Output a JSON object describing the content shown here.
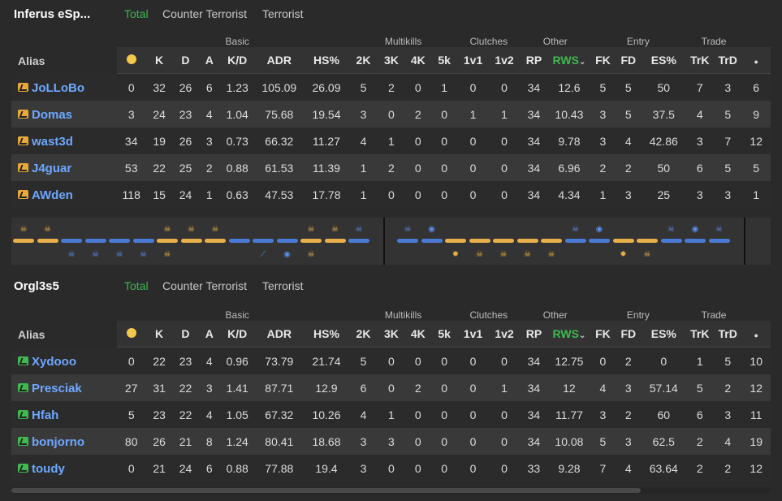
{
  "teams": [
    {
      "name": "Inferus eSp...",
      "tabs": [
        "Total",
        "Counter Terrorist",
        "Terrorist"
      ],
      "groups": {
        "basic": "Basic",
        "multikills": "Multikills",
        "clutches": "Clutches",
        "other": "Other",
        "entry": "Entry",
        "trade": "Trade"
      },
      "columns": {
        "alias": "Alias",
        "k": "K",
        "d": "D",
        "a": "A",
        "kd": "K/D",
        "adr": "ADR",
        "hs": "HS%",
        "k2": "2K",
        "k3": "3K",
        "k4": "4K",
        "k5": "5k",
        "c1": "1v1",
        "c2": "1v2",
        "rp": "RP",
        "rws": "RWS",
        "rws_sort": "⌄",
        "fk": "FK",
        "fd": "FD",
        "es": "ES%",
        "trk": "TrK",
        "trd": "TrD"
      },
      "players": [
        {
          "alias": "JoLLoBo",
          "mvp": "0",
          "k": "32",
          "d": "26",
          "a": "6",
          "kd": "1.23",
          "adr": "105.09",
          "hs": "26.09",
          "k2": "5",
          "k3": "2",
          "k4": "0",
          "k5": "1",
          "c1": "0",
          "c2": "0",
          "rp": "34",
          "rws": "12.6",
          "fk": "5",
          "fd": "5",
          "es": "50",
          "trk": "7",
          "trd": "3",
          "extra": "6"
        },
        {
          "alias": "Domas",
          "mvp": "3",
          "k": "24",
          "d": "23",
          "a": "4",
          "kd": "1.04",
          "adr": "75.68",
          "hs": "19.54",
          "k2": "3",
          "k3": "0",
          "k4": "2",
          "k5": "0",
          "c1": "1",
          "c2": "1",
          "rp": "34",
          "rws": "10.43",
          "fk": "3",
          "fd": "5",
          "es": "37.5",
          "trk": "4",
          "trd": "5",
          "extra": "9"
        },
        {
          "alias": "wast3d",
          "mvp": "34",
          "k": "19",
          "d": "26",
          "a": "3",
          "kd": "0.73",
          "adr": "66.32",
          "hs": "11.27",
          "k2": "4",
          "k3": "1",
          "k4": "0",
          "k5": "0",
          "c1": "0",
          "c2": "0",
          "rp": "34",
          "rws": "9.78",
          "fk": "3",
          "fd": "4",
          "es": "42.86",
          "trk": "3",
          "trd": "7",
          "extra": "12"
        },
        {
          "alias": "J4guar",
          "mvp": "53",
          "k": "22",
          "d": "25",
          "a": "2",
          "kd": "0.88",
          "adr": "61.53",
          "hs": "11.39",
          "k2": "1",
          "k3": "2",
          "k4": "0",
          "k5": "0",
          "c1": "0",
          "c2": "0",
          "rp": "34",
          "rws": "6.96",
          "fk": "2",
          "fd": "2",
          "es": "50",
          "trk": "6",
          "trd": "5",
          "extra": "5"
        },
        {
          "alias": "AWden",
          "mvp": "118",
          "k": "15",
          "d": "24",
          "a": "1",
          "kd": "0.63",
          "adr": "47.53",
          "hs": "17.78",
          "k2": "1",
          "k3": "0",
          "k4": "0",
          "k5": "0",
          "c1": "0",
          "c2": "0",
          "rp": "34",
          "rws": "4.34",
          "fk": "1",
          "fd": "3",
          "es": "25",
          "trk": "3",
          "trd": "3",
          "extra": "1"
        }
      ]
    },
    {
      "name": "Orgl3s5",
      "tabs": [
        "Total",
        "Counter Terrorist",
        "Terrorist"
      ],
      "groups": {
        "basic": "Basic",
        "multikills": "Multikills",
        "clutches": "Clutches",
        "other": "Other",
        "entry": "Entry",
        "trade": "Trade"
      },
      "columns": {
        "alias": "Alias",
        "k": "K",
        "d": "D",
        "a": "A",
        "kd": "K/D",
        "adr": "ADR",
        "hs": "HS%",
        "k2": "2K",
        "k3": "3K",
        "k4": "4K",
        "k5": "5k",
        "c1": "1v1",
        "c2": "1v2",
        "rp": "RP",
        "rws": "RWS",
        "rws_sort": "⌄",
        "fk": "FK",
        "fd": "FD",
        "es": "ES%",
        "trk": "TrK",
        "trd": "TrD"
      },
      "players": [
        {
          "alias": "Xydooo",
          "mvp": "0",
          "k": "22",
          "d": "23",
          "a": "4",
          "kd": "0.96",
          "adr": "73.79",
          "hs": "21.74",
          "k2": "5",
          "k3": "0",
          "k4": "0",
          "k5": "0",
          "c1": "0",
          "c2": "0",
          "rp": "34",
          "rws": "12.75",
          "fk": "0",
          "fd": "2",
          "es": "0",
          "trk": "1",
          "trd": "5",
          "extra": "10"
        },
        {
          "alias": "Presciak",
          "mvp": "27",
          "k": "31",
          "d": "22",
          "a": "3",
          "kd": "1.41",
          "adr": "87.71",
          "hs": "12.9",
          "k2": "6",
          "k3": "0",
          "k4": "2",
          "k5": "0",
          "c1": "0",
          "c2": "1",
          "rp": "34",
          "rws": "12",
          "fk": "4",
          "fd": "3",
          "es": "57.14",
          "trk": "5",
          "trd": "2",
          "extra": "12"
        },
        {
          "alias": "Hfah",
          "mvp": "5",
          "k": "23",
          "d": "22",
          "a": "4",
          "kd": "1.05",
          "adr": "67.32",
          "hs": "10.26",
          "k2": "4",
          "k3": "1",
          "k4": "0",
          "k5": "0",
          "c1": "0",
          "c2": "0",
          "rp": "34",
          "rws": "11.77",
          "fk": "3",
          "fd": "2",
          "es": "60",
          "trk": "6",
          "trd": "3",
          "extra": "11"
        },
        {
          "alias": "bonjorno",
          "mvp": "80",
          "k": "26",
          "d": "21",
          "a": "8",
          "kd": "1.24",
          "adr": "80.41",
          "hs": "18.68",
          "k2": "3",
          "k3": "3",
          "k4": "0",
          "k5": "0",
          "c1": "0",
          "c2": "0",
          "rp": "34",
          "rws": "10.08",
          "fk": "5",
          "fd": "3",
          "es": "62.5",
          "trk": "2",
          "trd": "4",
          "extra": "19"
        },
        {
          "alias": "toudy",
          "mvp": "0",
          "k": "21",
          "d": "24",
          "a": "6",
          "kd": "0.88",
          "adr": "77.88",
          "hs": "19.4",
          "k2": "3",
          "k3": "0",
          "k4": "0",
          "k5": "0",
          "c1": "0",
          "c2": "0",
          "rp": "33",
          "rws": "9.28",
          "fk": "7",
          "fd": "4",
          "es": "63.64",
          "trk": "2",
          "trd": "2",
          "extra": "12"
        }
      ]
    }
  ],
  "colors": {
    "accent_green": "#3fb950",
    "link_blue": "#6ea8ff",
    "t_side": "#e8b04a",
    "ct_side": "#4a7ad6"
  },
  "timeline": {
    "rounds": [
      "T",
      "T",
      "CT",
      "CT",
      "CT",
      "CT",
      "T",
      "T",
      "T",
      "CT",
      "CT",
      "CT",
      "T",
      "T",
      "CT",
      "CT",
      "CT",
      "T",
      "T",
      "T",
      "T",
      "T",
      "CT",
      "CT",
      "T",
      "T",
      "CT",
      "CT",
      "CT"
    ],
    "top_icons": [
      "skull",
      "skull",
      "",
      "",
      "",
      "",
      "skull",
      "skull",
      "skull",
      "",
      "",
      "",
      "skull",
      "skull",
      "skull",
      "skull",
      "defuse",
      "",
      "",
      "",
      "",
      "",
      "skull",
      "defuse",
      "",
      "",
      "skull",
      "defuse",
      "skull"
    ],
    "bottom_icons": [
      "",
      "",
      "skull",
      "skull",
      "skull",
      "skull",
      "skull",
      "",
      "",
      "",
      "knife",
      "defuse",
      "skull",
      "",
      "",
      "",
      "",
      "explode",
      "skull",
      "skull",
      "skull",
      "skull",
      "",
      "",
      "explode",
      "skull",
      "",
      "",
      ""
    ]
  }
}
